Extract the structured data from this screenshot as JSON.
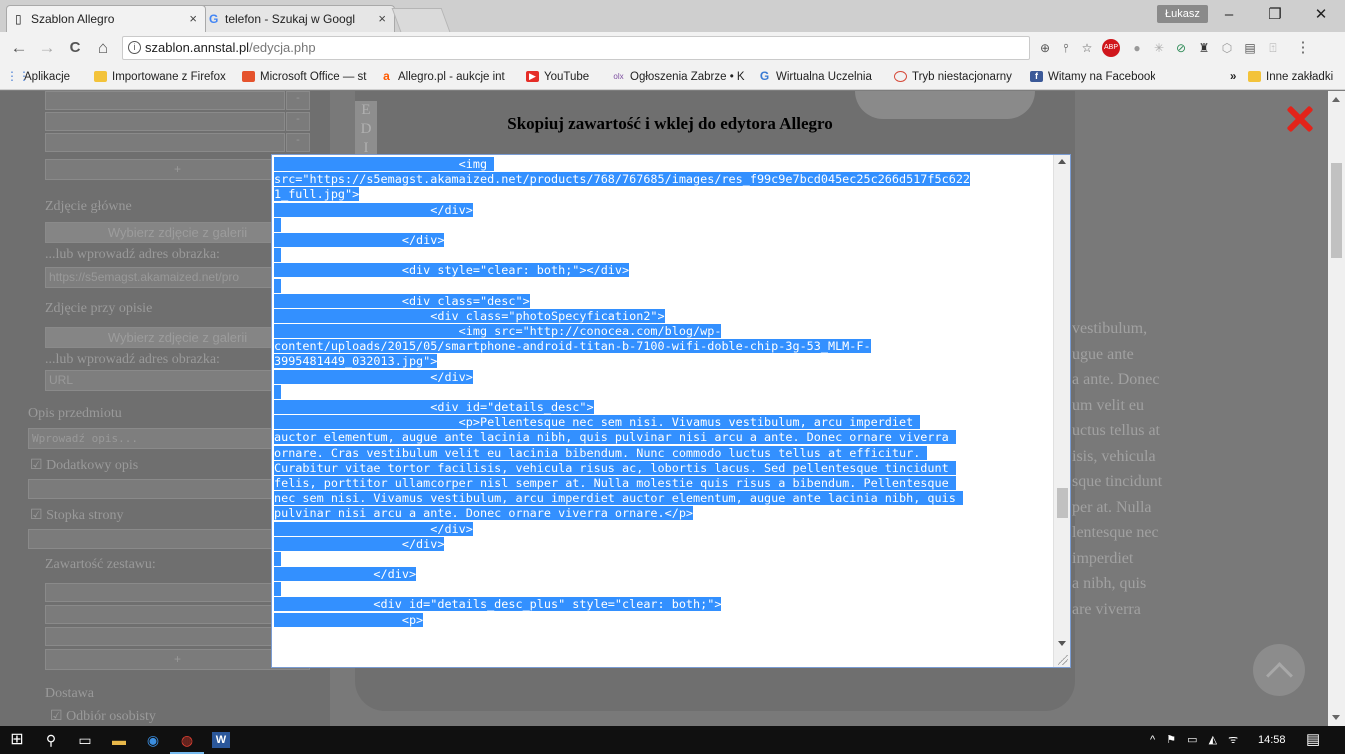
{
  "browser": {
    "tabs": [
      {
        "title": "Szablon Allegro",
        "icon": "page-icon",
        "close": "×"
      },
      {
        "title": "telefon - Szukaj w Googl",
        "icon": "google-icon",
        "close": "×"
      }
    ],
    "user_badge": "Łukasz",
    "window_buttons": {
      "minimize": "–",
      "maximize": "❐",
      "close": "✕"
    },
    "nav": {
      "back": "←",
      "forward": "→",
      "reload": "C",
      "home": "⌂"
    },
    "url": {
      "host": "szablon.annstal.pl",
      "path": "/edycja.php"
    },
    "extensions": [
      {
        "name": "zoom-icon",
        "glyph": "⊕"
      },
      {
        "name": "pin-icon",
        "glyph": "⫯"
      },
      {
        "name": "star-icon",
        "glyph": "☆"
      },
      {
        "name": "adblock-icon",
        "glyph": "ABP"
      },
      {
        "name": "ext-icon-1",
        "glyph": "●"
      },
      {
        "name": "ext-icon-2",
        "glyph": "✳"
      },
      {
        "name": "ext-icon-3",
        "glyph": "⊘"
      },
      {
        "name": "ext-icon-4",
        "glyph": "♜"
      },
      {
        "name": "ext-icon-5",
        "glyph": "⬡"
      },
      {
        "name": "ext-icon-6",
        "glyph": "▤"
      },
      {
        "name": "ext-icon-7",
        "glyph": "⍐"
      },
      {
        "name": "menu-icon",
        "glyph": "⋮"
      }
    ],
    "bookmarks": [
      {
        "label": "Aplikacje",
        "color": "#4a7fd6"
      },
      {
        "label": "Importowane z Firefox",
        "color": "#f3c33a"
      },
      {
        "label": "Microsoft Office — st",
        "color": "#e5532d"
      },
      {
        "label": "Allegro.pl - aukcje int",
        "color": "#ff5a00"
      },
      {
        "label": "YouTube",
        "color": "#e52d27"
      },
      {
        "label": "Ogłoszenia Zabrze • K",
        "color": "#7d4ea0"
      },
      {
        "label": "Wirtualna Uczelnia",
        "color": "#3b7bd3"
      },
      {
        "label": "Tryb niestacjonarny",
        "color": "#d64a3a"
      },
      {
        "label": "Witamy na Facebooku",
        "color": "#3b5998"
      }
    ],
    "bookmarks_more": "»",
    "other_bookmarks": "Inne zakładki"
  },
  "page_bg": {
    "sidebar": {
      "main_photo_label": "Zdjęcie główne",
      "choose_gallery": "Wybierz zdjęcie z galerii",
      "or_enter_url": "...lub wprowadź adres obrazka:",
      "main_photo_url": "https://s5emagst.akamaized.net/pro",
      "desc_photo_label": "Zdjęcie przy opisie",
      "choose_gallery_2": "Wybierz zdjęcie z galerii",
      "or_enter_url_2": "...lub wprowadź adres obrazka:",
      "url_placeholder": "URL",
      "item_desc_label": "Opis przedmiotu",
      "item_desc_placeholder": "Wprowadź opis...",
      "additional_desc": "Dodatkowy opis",
      "footer": "Stopka strony",
      "set_contents": "Zawartość zestawu:",
      "delivery": "Dostawa",
      "pickup": "Odbiór osobisty",
      "plus": "+",
      "minus": "-"
    },
    "right_text": [
      "vestibulum,",
      "ugue ante",
      "a ante. Donec",
      "um velit eu",
      "uctus tellus at",
      "isis, vehicula",
      "sque tincidunt",
      "per at. Nulla",
      "lentesque nec",
      "imperdiet",
      "a nibh, quis",
      "are viverra"
    ],
    "phone_letters": [
      "E",
      "D",
      "I"
    ]
  },
  "modal": {
    "title": "Skopiuj zawartość i wklej do edytora Allegro",
    "close_icon": "close-icon",
    "code_lines": [
      "                          <img ",
      "src=\"https://s5emagst.akamaized.net/products/768/767685/images/res_f99c9e7bcd045ec25c266d517f5c622",
      "1_full.jpg\">",
      "                      </div>",
      "",
      "                  </div>",
      "",
      "                  <div style=\"clear: both;\"></div>",
      "",
      "                  <div class=\"desc\">",
      "                      <div class=\"photoSpecyfication2\">",
      "                          <img src=\"http://conocea.com/blog/wp-",
      "content/uploads/2015/05/smartphone-android-titan-b-7100-wifi-doble-chip-3g-53_MLM-F-",
      "3995481449_032013.jpg\">",
      "                      </div>",
      "",
      "                      <div id=\"details_desc\">",
      "                          <p>Pellentesque nec sem nisi. Vivamus vestibulum, arcu imperdiet ",
      "auctor elementum, augue ante lacinia nibh, quis pulvinar nisi arcu a ante. Donec ornare viverra ",
      "ornare. Cras vestibulum velit eu lacinia bibendum. Nunc commodo luctus tellus at efficitur. ",
      "Curabitur vitae tortor facilisis, vehicula risus ac, lobortis lacus. Sed pellentesque tincidunt ",
      "felis, porttitor ullamcorper nisl semper at. Nulla molestie quis risus a bibendum. Pellentesque ",
      "nec sem nisi. Vivamus vestibulum, arcu imperdiet auctor elementum, augue ante lacinia nibh, quis ",
      "pulvinar nisi arcu a ante. Donec ornare viverra ornare.</p>",
      "                      </div>",
      "                  </div>",
      "",
      "              </div>",
      "",
      "              <div id=\"details_desc_plus\" style=\"clear: both;\">",
      "                  <p>"
    ]
  },
  "taskbar": {
    "icons": [
      {
        "name": "windows-start-icon",
        "glyph": "⊞"
      },
      {
        "name": "search-icon",
        "glyph": "⚲"
      },
      {
        "name": "task-view-icon",
        "glyph": "▭"
      },
      {
        "name": "file-explorer-icon",
        "glyph": "▬"
      },
      {
        "name": "edge-icon",
        "glyph": "◉"
      },
      {
        "name": "chrome-icon",
        "glyph": "◍"
      },
      {
        "name": "word-icon",
        "glyph": "W"
      }
    ],
    "tray_icons": "^ ⚑ ▭ ◭ ᯤ",
    "time": "14:58",
    "notifications": "▤"
  }
}
